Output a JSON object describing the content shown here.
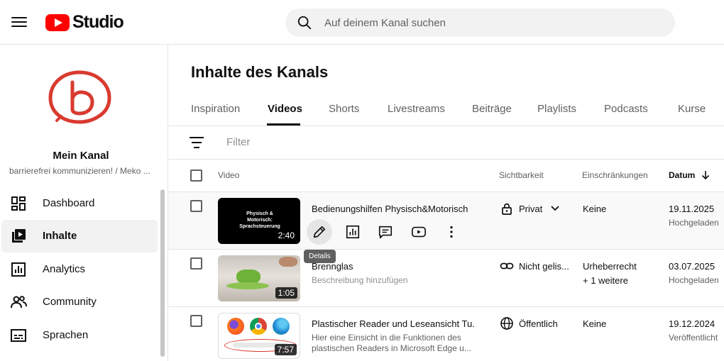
{
  "header": {
    "logo_text": "Studio",
    "search_placeholder": "Auf deinem Kanal suchen"
  },
  "sidebar": {
    "channel_name": "Mein Kanal",
    "channel_sub": "barrierefrei kommunizieren! / Meko ...",
    "items": [
      {
        "label": "Dashboard",
        "icon": "dashboard-icon"
      },
      {
        "label": "Inhalte",
        "icon": "content-icon",
        "active": true
      },
      {
        "label": "Analytics",
        "icon": "analytics-icon"
      },
      {
        "label": "Community",
        "icon": "community-icon"
      },
      {
        "label": "Sprachen",
        "icon": "subtitles-icon"
      }
    ]
  },
  "main": {
    "title": "Inhalte des Kanals",
    "tabs": [
      "Inspiration",
      "Videos",
      "Shorts",
      "Livestreams",
      "Beiträge",
      "Playlists",
      "Podcasts",
      "Kurse"
    ],
    "active_tab": "Videos",
    "filter_placeholder": "Filter",
    "columns": {
      "video": "Video",
      "visibility": "Sichtbarkeit",
      "restrictions": "Einschränkungen",
      "date": "Datum"
    },
    "tooltip": "Details",
    "rows": [
      {
        "title": "Bedienungshilfen Physisch&Motorisch",
        "thumb_text": "Physisch & Motorisch: Sprachsteuerung",
        "duration": "2:40",
        "visibility": "Privat",
        "visibility_icon": "lock-icon",
        "restriction": "Keine",
        "date": "19.11.2025",
        "status": "Hochgeladen"
      },
      {
        "title": "Brennglas",
        "description": "Beschreibung hinzufügen",
        "duration": "1:05",
        "visibility": "Nicht gelis...",
        "visibility_icon": "link-icon",
        "restriction": "Urheberrecht",
        "restriction_extra": "+ 1 weitere",
        "date": "03.07.2025",
        "status": "Hochgeladen"
      },
      {
        "title": "Plastischer Reader und Leseansicht Tu...",
        "description": "Hier eine Einsicht in die Funktionen des plastischen Readers in Microsoft Edge u...",
        "duration": "7:57",
        "visibility": "Öffentlich",
        "visibility_icon": "globe-icon",
        "restriction": "Keine",
        "date": "19.12.2024",
        "status": "Veröffentlicht"
      }
    ]
  },
  "colors": {
    "brand_red": "#ff0000",
    "avatar_red": "#d93a2f"
  }
}
